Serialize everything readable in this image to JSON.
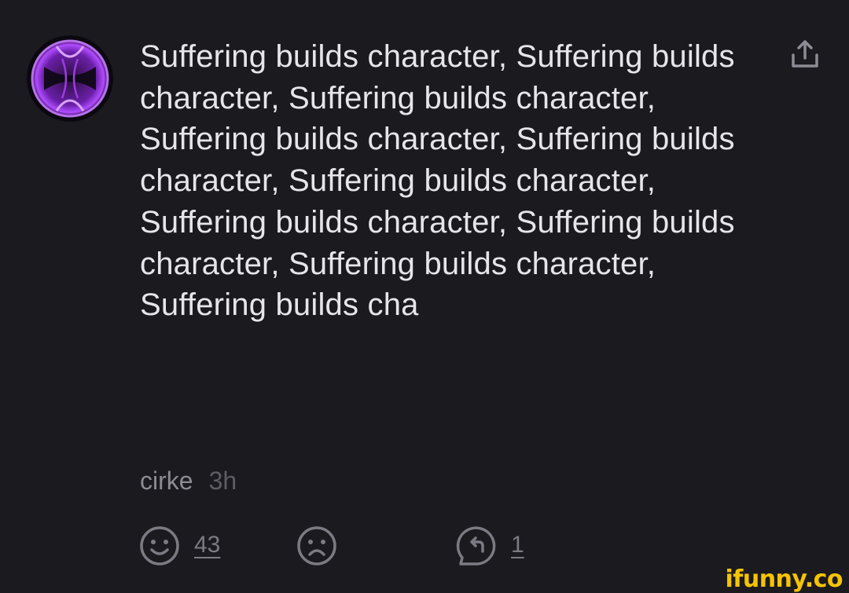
{
  "comment": {
    "text": "Suffering builds character, Suffering builds character, Suffering builds character, Suffering builds character, Suffering builds character, Suffering builds character, Suffering builds character, Suffering builds character, Suffering builds character, Suffering builds cha",
    "author": "cirke",
    "time": "3h"
  },
  "reactions": {
    "smile_count": "43",
    "reply_count": "1"
  },
  "icons": {
    "avatar": "avatar-image",
    "share": "share-icon",
    "smile": "smile-icon",
    "frown": "frown-icon",
    "reply": "reply-icon"
  },
  "watermark": "ifunny.co",
  "colors": {
    "background": "#1b1a1f",
    "text": "#e6e5ea",
    "muted": "#8d8b93",
    "icon": "#7c7a82",
    "accent": "#f5c400",
    "avatar_glow": "#b04cff"
  }
}
